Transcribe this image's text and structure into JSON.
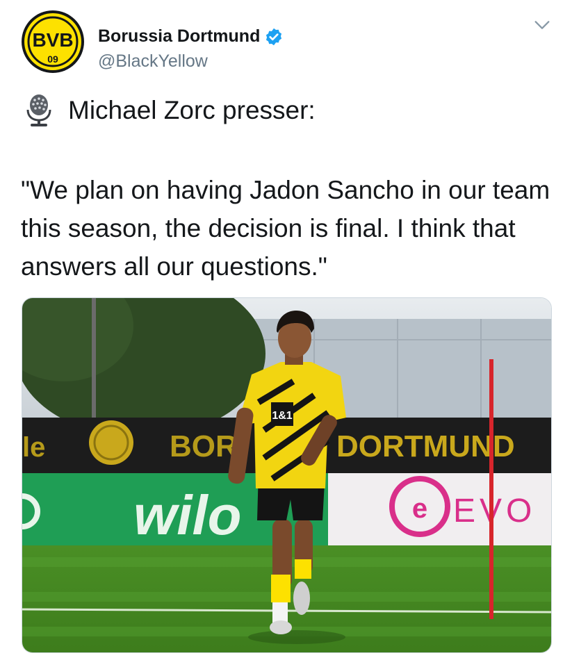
{
  "account": {
    "display_name": "Borussia Dortmund",
    "handle": "@BlackYellow",
    "avatar_text": "BVB",
    "avatar_sub": "09",
    "verified": true
  },
  "tweet": {
    "line1_emoji": "studio-microphone-icon",
    "line1": "Michael Zorc presser:",
    "quote": "\"We plan on having Jadon Sancho in our team this season, the decision is final. I think that answers all our questions.\""
  },
  "media": {
    "ad_board_text": "DORTMUND",
    "ad_board_partial": "BOR",
    "ad_board_left": "le",
    "sponsor_left": "wilo",
    "sponsor_right": "EVO",
    "shirt_sponsor": "1&1"
  },
  "colors": {
    "bvb_yellow": "#fde100",
    "verified_blue": "#1da1f2",
    "handle_gray": "#657786",
    "pitch_green": "#4f9a2a"
  }
}
